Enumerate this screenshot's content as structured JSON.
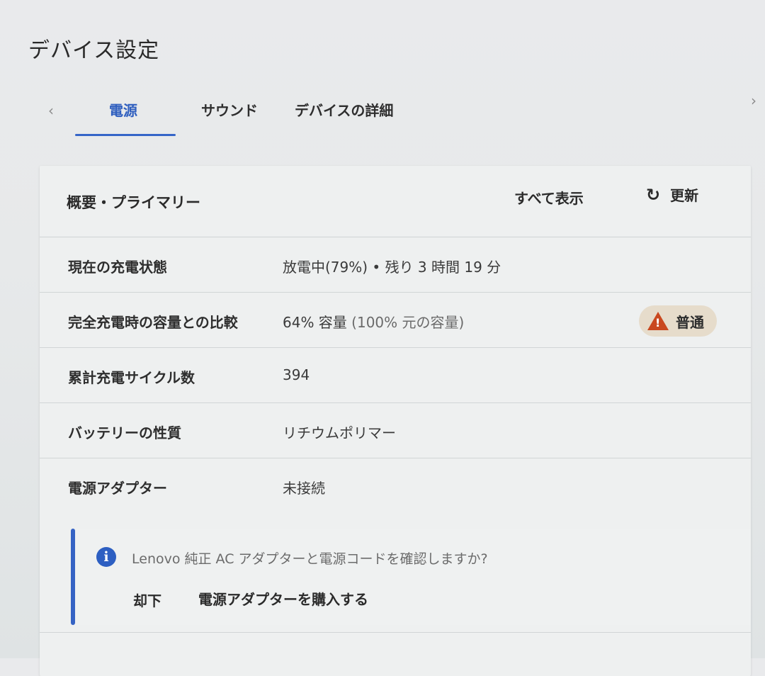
{
  "page": {
    "title": "デバイス設定"
  },
  "tabs": [
    {
      "label": "電源",
      "active": true
    },
    {
      "label": "サウンド",
      "active": false
    },
    {
      "label": "デバイスの詳細",
      "active": false
    }
  ],
  "nav": {
    "left_icon": "chevron-left-icon",
    "right_icon": "chevron-right-icon",
    "left_glyph": "‹",
    "right_glyph": "›"
  },
  "card": {
    "title": "概要・プライマリー",
    "show_all_label": "すべて表示",
    "refresh_label": "更新",
    "refresh_glyph": "↻"
  },
  "rows": [
    {
      "label": "現在の充電状態",
      "value": "放電中(79%) • 残り 3 時間 19 分"
    },
    {
      "label": "完全充電時の容量との比較",
      "value": "64% 容量",
      "value_muted": " (100% 元の容量)",
      "badge": "普通"
    },
    {
      "label": "累計充電サイクル数",
      "value": "394"
    },
    {
      "label": "バッテリーの性質",
      "value": "リチウムポリマー"
    },
    {
      "label": "電源アダプター",
      "value": "未接続"
    }
  ],
  "notice": {
    "icon_glyph": "i",
    "text": "Lenovo 純正 AC アダプターと電源コードを確認しますか?",
    "dismiss_label": "却下",
    "buy_label": "電源アダプターを購入する"
  },
  "colors": {
    "accent": "#3565c8",
    "warning": "#c9481f",
    "badge_bg": "#e6dccb"
  }
}
